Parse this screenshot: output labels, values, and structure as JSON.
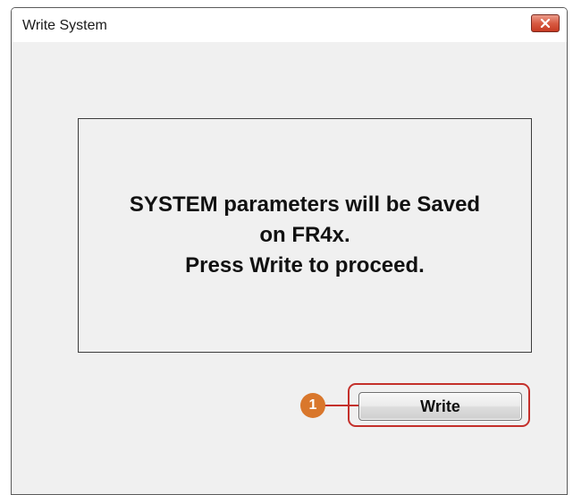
{
  "window": {
    "title": "Write System",
    "close_icon": "close-icon"
  },
  "message": {
    "lines": [
      "SYSTEM parameters will be Saved",
      "on FR4x.",
      "Press Write to proceed."
    ]
  },
  "actions": {
    "write_label": "Write"
  },
  "callout": {
    "number": "1",
    "badge_color": "#d9772c",
    "highlight_color": "#c4302b"
  }
}
